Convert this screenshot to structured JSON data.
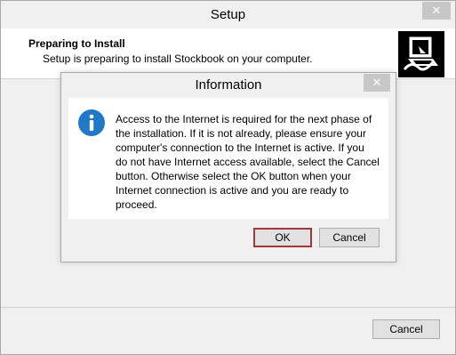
{
  "setup": {
    "title": "Setup",
    "close_glyph": "✕",
    "header": {
      "title": "Preparing to Install",
      "subtitle": "Setup is preparing to install Stockbook on your computer.",
      "logo_icon": "computer-install-icon"
    },
    "cancel_label": "Cancel"
  },
  "dialog": {
    "title": "Information",
    "close_glyph": "✕",
    "icon": "info-icon",
    "message_lines": [
      "Access to the Internet is required for the next phase of",
      "the installation. If it is not already, please ensure your",
      "computer's connection to the Internet is active. If you",
      "do not have Internet access available, select the Cancel",
      "button. Otherwise select the OK button when your",
      "Internet connection is active and you are ready to",
      "proceed."
    ],
    "ok_label": "OK",
    "cancel_label": "Cancel"
  },
  "colors": {
    "info_icon": "#1f78c8",
    "ok_focus_border": "#a4373a"
  }
}
